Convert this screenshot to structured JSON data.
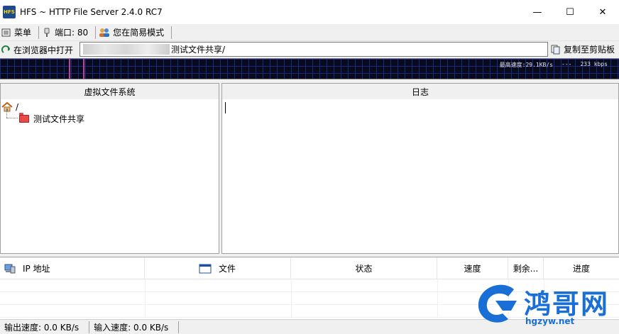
{
  "window": {
    "title": "HFS ~ HTTP File Server 2.4.0 RC7",
    "icon_label": "HFS",
    "controls": {
      "minimize": "—",
      "maximize": "☐",
      "close": "✕"
    }
  },
  "toolbar": {
    "menu_label": "菜单",
    "port_label": "端口: 80",
    "mode_label": "您在简易模式"
  },
  "urlbar": {
    "open_label": "在浏览器中打开",
    "url_visible": "测试文件共享/",
    "copy_label": "复制至剪贴板"
  },
  "graph": {
    "max_speed": "最高速度:29.1KB/s",
    "separator": "---",
    "bandwidth": "233 kbps",
    "line_color": "#c040a0"
  },
  "vfs": {
    "header": "虚拟文件系统",
    "root": "/",
    "items": [
      {
        "label": "测试文件共享"
      }
    ]
  },
  "log": {
    "header": "日志"
  },
  "connections": {
    "columns": [
      "IP 地址",
      "文件",
      "状态",
      "速度",
      "剩余...",
      "进度"
    ]
  },
  "status": {
    "output_speed": "输出速度: 0.0 KB/s",
    "input_speed": "输入速度: 0.0 KB/s"
  },
  "watermark": {
    "brand": "鸿哥网",
    "site": "hgzyw.net",
    "color": "#1a6fd6"
  }
}
